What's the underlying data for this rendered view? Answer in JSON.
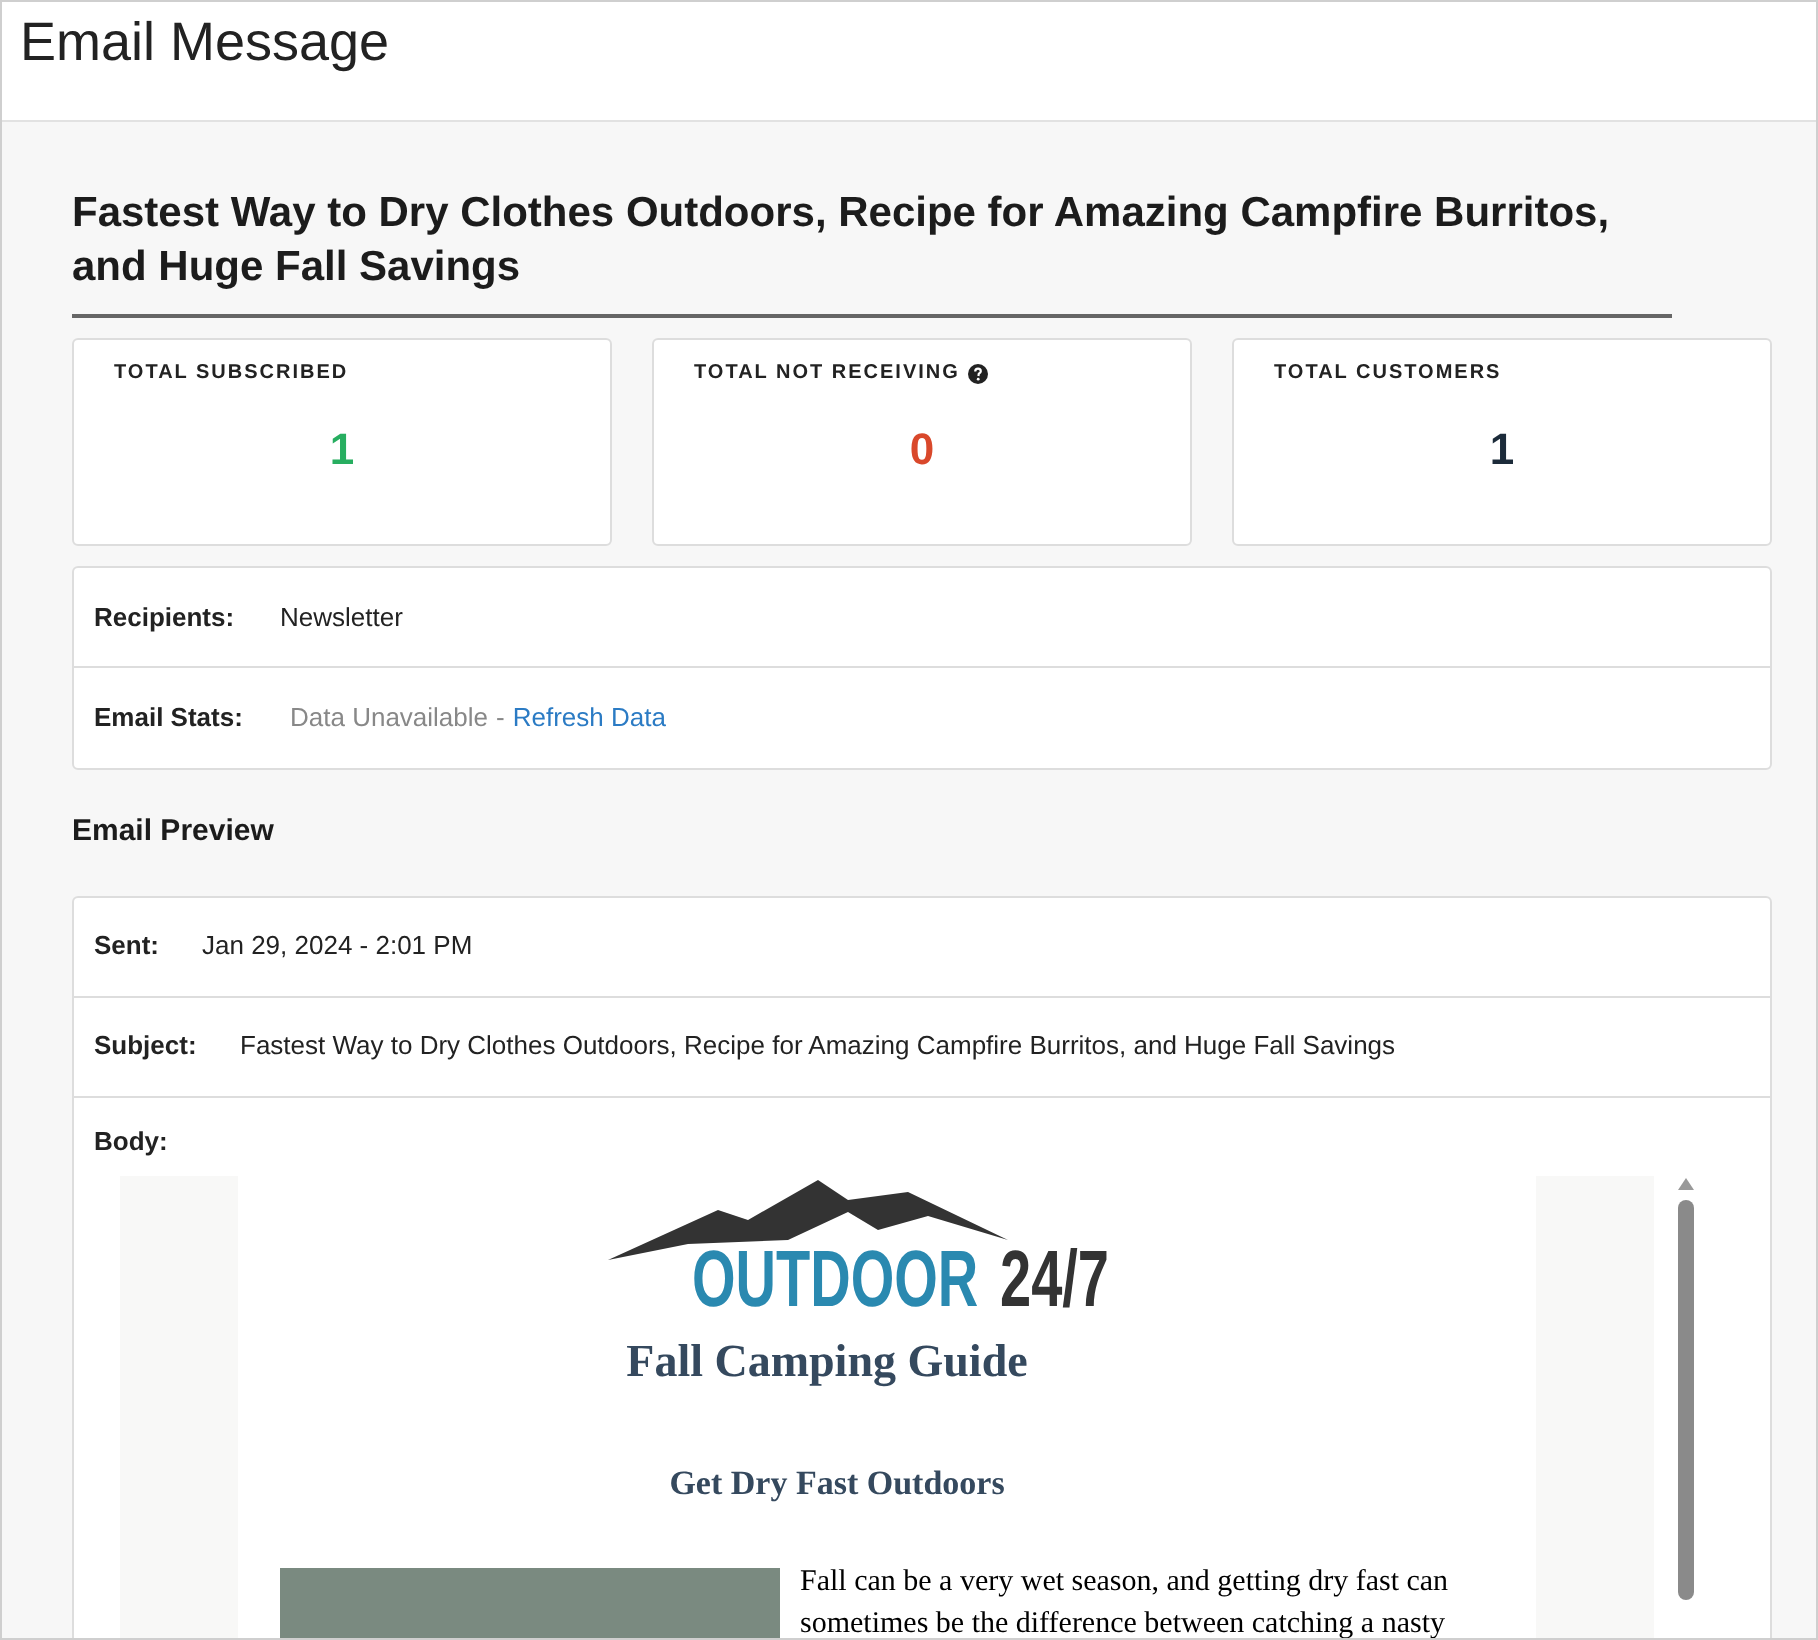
{
  "page_title": "Email Message",
  "email_title": "Fastest Way to Dry Clothes Outdoors, Recipe for Amazing Campfire Burritos, and Huge Fall Savings",
  "stats": [
    {
      "label": "TOTAL SUBSCRIBED",
      "value": "1",
      "color": "#27ae60",
      "help": false
    },
    {
      "label": "TOTAL NOT RECEIVING",
      "value": "0",
      "color": "#d9482b",
      "help": true
    },
    {
      "label": "TOTAL CUSTOMERS",
      "value": "1",
      "color": "#1c2b3a",
      "help": false
    }
  ],
  "details": {
    "recipients_label": "Recipients:",
    "recipients": "Newsletter",
    "stats_label": "Email Stats:",
    "stats_status": "Data Unavailable",
    "separator": "-",
    "refresh_link": "Refresh Data"
  },
  "preview": {
    "heading": "Email Preview",
    "sent_label": "Sent:",
    "sent": "Jan 29, 2024 - 2:01 PM",
    "subject_label": "Subject:",
    "subject": "Fastest Way to Dry Clothes Outdoors, Recipe for Amazing Campfire Burritos, and Huge Fall Savings",
    "body_label": "Body:"
  },
  "email_body": {
    "logo_word": "OUTDOOR",
    "logo_number": "24/7",
    "guide_title": "Fall Camping Guide",
    "article_title": "Get Dry Fast Outdoors",
    "article_lines": [
      "Fall can be a very wet season, and getting dry fast can",
      "sometimes be the difference between catching a nasty"
    ]
  }
}
